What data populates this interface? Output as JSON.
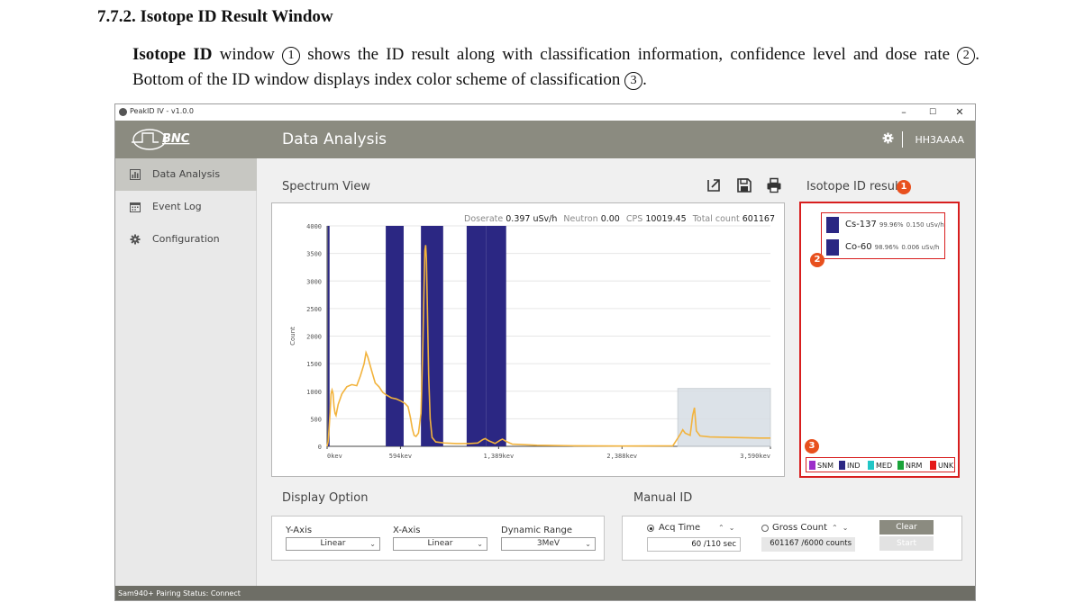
{
  "doc": {
    "heading": "7.7.2. Isotope ID Result Window",
    "para_bold": "Isotope ID",
    "para_1": " window ",
    "mark_1": "1",
    "para_2": " shows the ID result along with classification information, confidence level and dose rate ",
    "mark_2": "2",
    "para_3": ". Bottom of the ID window displays index color scheme of classification ",
    "mark_3": "3",
    "para_4": "."
  },
  "window": {
    "title": "PeakID IV - v1.0.0",
    "controls": {
      "minimize": "–",
      "maximize": "☐",
      "close": "✕"
    }
  },
  "sidebar": {
    "logo_text": "BNC",
    "items": [
      {
        "label": "Data Analysis",
        "icon": "chart-icon",
        "active": true
      },
      {
        "label": "Event Log",
        "icon": "calendar-icon",
        "active": false
      },
      {
        "label": "Configuration",
        "icon": "gear-icon",
        "active": false
      }
    ]
  },
  "header": {
    "title": "Data Analysis",
    "user": "HH3AAAA",
    "settings_icon": "gear-icon"
  },
  "spectrum": {
    "section_label": "Spectrum View",
    "toolbar_icons": [
      "export-icon",
      "save-icon",
      "print-icon"
    ],
    "stats": {
      "doserate_label": "Doserate",
      "doserate_value": "0.397 uSv/h",
      "neutron_label": "Neutron",
      "neutron_value": "0.00",
      "cps_label": "CPS",
      "cps_value": "10019.45",
      "total_label": "Total count",
      "total_value": "601167"
    }
  },
  "chart_data": {
    "type": "line",
    "title": "",
    "xlabel": "",
    "ylabel": "Count",
    "xlim": [
      0,
      3590
    ],
    "ylim": [
      0,
      4000
    ],
    "x_ticks": [
      {
        "value": 0,
        "label": "0kev"
      },
      {
        "value": 594,
        "label": "594kev"
      },
      {
        "value": 1389,
        "label": "1,389kev"
      },
      {
        "value": 2388,
        "label": "2,388kev"
      },
      {
        "value": 3590,
        "label": "3,590kev"
      }
    ],
    "y_ticks": [
      0,
      500,
      1000,
      1500,
      2000,
      2500,
      3000,
      3500,
      4000
    ],
    "grid": true,
    "colors": {
      "line": "#f2b33d",
      "band": "#2b2783",
      "roi": "#d7dde4"
    },
    "roi_bands": [
      {
        "x0": 5,
        "x1": 20
      },
      {
        "x0": 475,
        "x1": 620
      },
      {
        "x0": 760,
        "x1": 940
      },
      {
        "x0": 1130,
        "x1": 1290
      },
      {
        "x0": 1290,
        "x1": 1450
      }
    ],
    "zoom_window": {
      "x0": 2840,
      "x1": 3590,
      "y0": 0,
      "y1": 1050
    },
    "series": [
      {
        "values": [
          [
            0,
            0
          ],
          [
            8,
            80
          ],
          [
            16,
            320
          ],
          [
            24,
            620
          ],
          [
            32,
            950
          ],
          [
            40,
            1020
          ],
          [
            48,
            960
          ],
          [
            56,
            720
          ],
          [
            64,
            600
          ],
          [
            72,
            560
          ],
          [
            90,
            760
          ],
          [
            120,
            950
          ],
          [
            160,
            1080
          ],
          [
            200,
            1120
          ],
          [
            240,
            1100
          ],
          [
            270,
            1280
          ],
          [
            300,
            1500
          ],
          [
            315,
            1700
          ],
          [
            330,
            1620
          ],
          [
            360,
            1380
          ],
          [
            390,
            1150
          ],
          [
            420,
            1080
          ],
          [
            450,
            980
          ],
          [
            480,
            930
          ],
          [
            520,
            880
          ],
          [
            560,
            860
          ],
          [
            600,
            820
          ],
          [
            630,
            780
          ],
          [
            655,
            720
          ],
          [
            675,
            520
          ],
          [
            690,
            320
          ],
          [
            705,
            200
          ],
          [
            720,
            180
          ],
          [
            740,
            240
          ],
          [
            760,
            600
          ],
          [
            775,
            1800
          ],
          [
            785,
            2900
          ],
          [
            792,
            3550
          ],
          [
            798,
            3650
          ],
          [
            804,
            3400
          ],
          [
            812,
            2500
          ],
          [
            822,
            1300
          ],
          [
            835,
            500
          ],
          [
            850,
            160
          ],
          [
            880,
            80
          ],
          [
            950,
            60
          ],
          [
            1050,
            50
          ],
          [
            1150,
            50
          ],
          [
            1220,
            60
          ],
          [
            1260,
            120
          ],
          [
            1280,
            140
          ],
          [
            1310,
            100
          ],
          [
            1360,
            50
          ],
          [
            1400,
            110
          ],
          [
            1420,
            130
          ],
          [
            1450,
            90
          ],
          [
            1500,
            40
          ],
          [
            1700,
            20
          ],
          [
            2000,
            10
          ],
          [
            2400,
            5
          ],
          [
            2800,
            10
          ],
          [
            2860,
            220
          ],
          [
            2880,
            300
          ],
          [
            2900,
            240
          ],
          [
            2940,
            200
          ],
          [
            2960,
            560
          ],
          [
            2975,
            700
          ],
          [
            2990,
            280
          ],
          [
            3020,
            190
          ],
          [
            3100,
            170
          ],
          [
            3300,
            160
          ],
          [
            3500,
            150
          ],
          [
            3590,
            150
          ]
        ]
      }
    ]
  },
  "isotope": {
    "section_label": "Isotope ID result",
    "results": [
      {
        "name": "Cs-137",
        "confidence": "99.96%",
        "dose": "0.150 uSv/h",
        "color": "#2b2783"
      },
      {
        "name": "Co-60",
        "confidence": "98.96%",
        "dose": "0.006 uSv/h",
        "color": "#2b2783"
      }
    ],
    "legend": [
      {
        "label": "SNM",
        "color": "#9b2fc9"
      },
      {
        "label": "IND",
        "color": "#2b2783"
      },
      {
        "label": "MED",
        "color": "#22c6c6"
      },
      {
        "label": "NRM",
        "color": "#1aa33a"
      },
      {
        "label": "UNK",
        "color": "#e51a1a"
      }
    ],
    "badges": {
      "b1": "1",
      "b2": "2",
      "b3": "3"
    }
  },
  "display_option": {
    "section_label": "Display Option",
    "y_axis_label": "Y-Axis",
    "y_axis_value": "Linear",
    "x_axis_label": "X-Axis",
    "x_axis_value": "Linear",
    "range_label": "Dynamic Range",
    "range_value": "3MeV"
  },
  "manual_id": {
    "section_label": "Manual ID",
    "acq_label": "Acq Time",
    "acq_value": "60 /110 sec",
    "acq_selected": true,
    "gross_label": "Gross Count",
    "gross_value": "601167 /6000 counts",
    "gross_selected": false,
    "clear_label": "Clear",
    "start_label": "Start"
  },
  "status": {
    "text": "Sam940+ Pairing Status: Connect"
  }
}
